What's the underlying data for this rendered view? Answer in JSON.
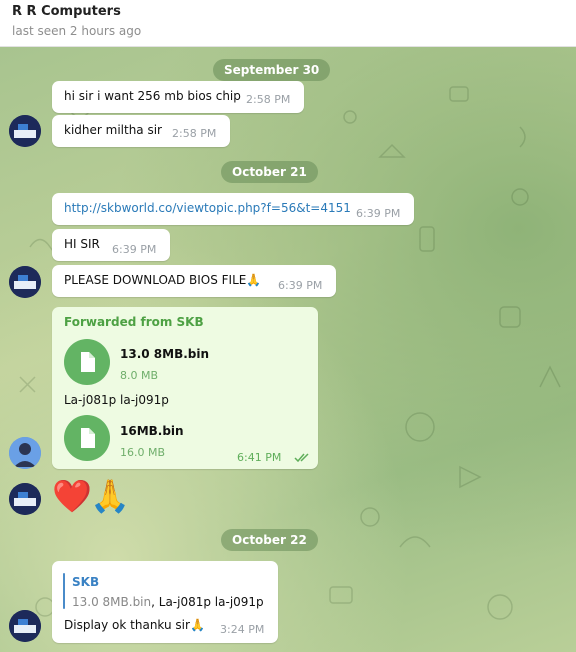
{
  "header": {
    "title": "R R Computers",
    "status": "last seen 2 hours ago"
  },
  "dates": {
    "d1": "September 30",
    "d2": "October 21",
    "d3": "October 22"
  },
  "messages": {
    "m1": {
      "text": "hi sir i want 256 mb bios chip",
      "time": "2:58 PM"
    },
    "m2": {
      "text": "kidher miltha sir",
      "time": "2:58 PM"
    },
    "m3": {
      "text": "http://skbworld.co/viewtopic.php?f=56&t=4151",
      "time": "6:39 PM"
    },
    "m4": {
      "text": "HI SIR",
      "time": "6:39 PM"
    },
    "m5": {
      "text": "PLEASE DOWNLOAD BIOS FILE",
      "emoji": "🙏",
      "time": "6:39 PM"
    },
    "fwd": {
      "label": "Forwarded from SKB",
      "file1": {
        "name": "13.0 8MB.bin",
        "size": "8.0 MB"
      },
      "caption": "La-j081p la-j091p",
      "file2": {
        "name": "16MB.bin",
        "size": "16.0 MB"
      },
      "time": "6:41 PM"
    },
    "m6": {
      "emoji1": "❤️",
      "emoji2": "🙏"
    },
    "m7": {
      "reply_name": "SKB",
      "reply_file": "13.0 8MB.bin",
      "reply_sep": ", ",
      "reply_caption": "La-j081p la-j091p",
      "text": "Display ok thanku sir",
      "emoji": "🙏",
      "time": "3:24 PM"
    }
  },
  "colors": {
    "accent_green": "#63b464",
    "link": "#2a7ab8",
    "date_pill": "#688c58"
  }
}
